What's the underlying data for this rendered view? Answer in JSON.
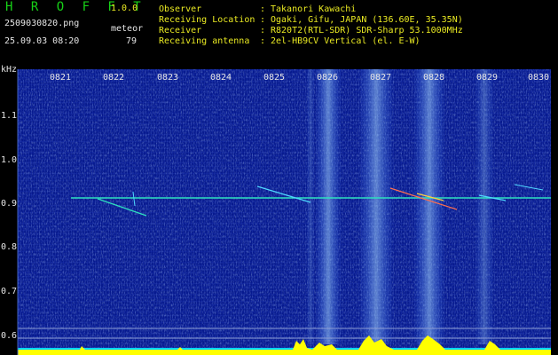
{
  "header": {
    "app_title": "H R O F F T",
    "app_version": "1.0.0",
    "filename": "2509030820.png",
    "timestamp": "25.09.03 08:20",
    "meteor_label": "meteor",
    "meteor_count": "79",
    "info": [
      {
        "label": "Observer",
        "value": "Takanori Kawachi"
      },
      {
        "label": "Receiving Location",
        "value": "Ogaki, Gifu, JAPAN (136.60E, 35.35N)"
      },
      {
        "label": "Receiver",
        "value": "R820T2(RTL-SDR) SDR-Sharp 53.1000MHz"
      },
      {
        "label": "Receiving antenna",
        "value": "2el-HB9CV Vertical (el. E-W)"
      }
    ]
  },
  "spectrogram": {
    "y_unit": "kHz",
    "y_ticks": [
      "1.1",
      "1.0",
      "0.9",
      "0.8",
      "0.7",
      "0.6"
    ],
    "x_ticks": [
      "0821",
      "0822",
      "0823",
      "0824",
      "0825",
      "0826",
      "0827",
      "0828",
      "0829",
      "0830"
    ],
    "colors": {
      "background": "#071a8f",
      "carrier": "#2ee0c0",
      "echo": "#4fd8ff",
      "level_bar": "#ffff00",
      "level_base": "#00d8ff"
    }
  }
}
